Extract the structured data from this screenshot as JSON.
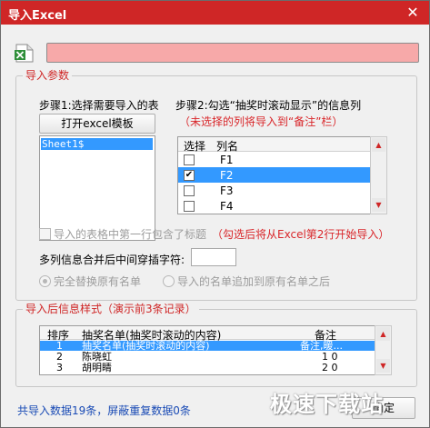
{
  "window": {
    "title": "导入Excel",
    "close_glyph": "✕"
  },
  "params": {
    "legend": "导入参数",
    "step1_label": "步骤1:选择需要导入的表",
    "open_template_button": "打开excel模板",
    "sheets": [
      "Sheet1$"
    ],
    "step2_label": "步骤2:勾选“抽奖时滚动显示”的信息列",
    "step2_note": "（未选择的列将导入到“备注”栏）",
    "columns_header": {
      "select": "选择",
      "name": "列名"
    },
    "columns": [
      {
        "name": "F1",
        "checked": false,
        "selected": false
      },
      {
        "name": "F2",
        "checked": true,
        "selected": true
      },
      {
        "name": "F3",
        "checked": false,
        "selected": false
      },
      {
        "name": "F4",
        "checked": false,
        "selected": false
      }
    ],
    "first_row_title_label": "导入的表格中第一行包含了标题",
    "first_row_title_note": "（勾选后将从Excel第2行开始导入）",
    "separator_label": "多列信息合并后中间穿插字符:",
    "separator_value": "",
    "replace_label": "完全替换原有名单",
    "append_label": "导入的名单追加到原有名单之后"
  },
  "preview": {
    "legend": "导入后信息样式（演示前3条记录）",
    "headers": {
      "index": "排序",
      "name": "抽奖名单(抽奖时滚动的内容)",
      "note": "备注"
    },
    "rows": [
      {
        "index": "1",
        "name": "抽奖名单(抽奖时滚动的内容)",
        "note": "备注,暖...",
        "selected": true
      },
      {
        "index": "2",
        "name": "陈晓虹",
        "note": "1 0",
        "selected": false
      },
      {
        "index": "3",
        "name": "胡明睛",
        "note": "2 0",
        "selected": false
      }
    ]
  },
  "status": "共导入数据19条，屏蔽重复数据0条",
  "confirm_button": "确定",
  "watermark": "极速下载站",
  "colors": {
    "accent": "#cf2626",
    "selection": "#3399ff",
    "progress_fill": "#f7a9a9"
  }
}
